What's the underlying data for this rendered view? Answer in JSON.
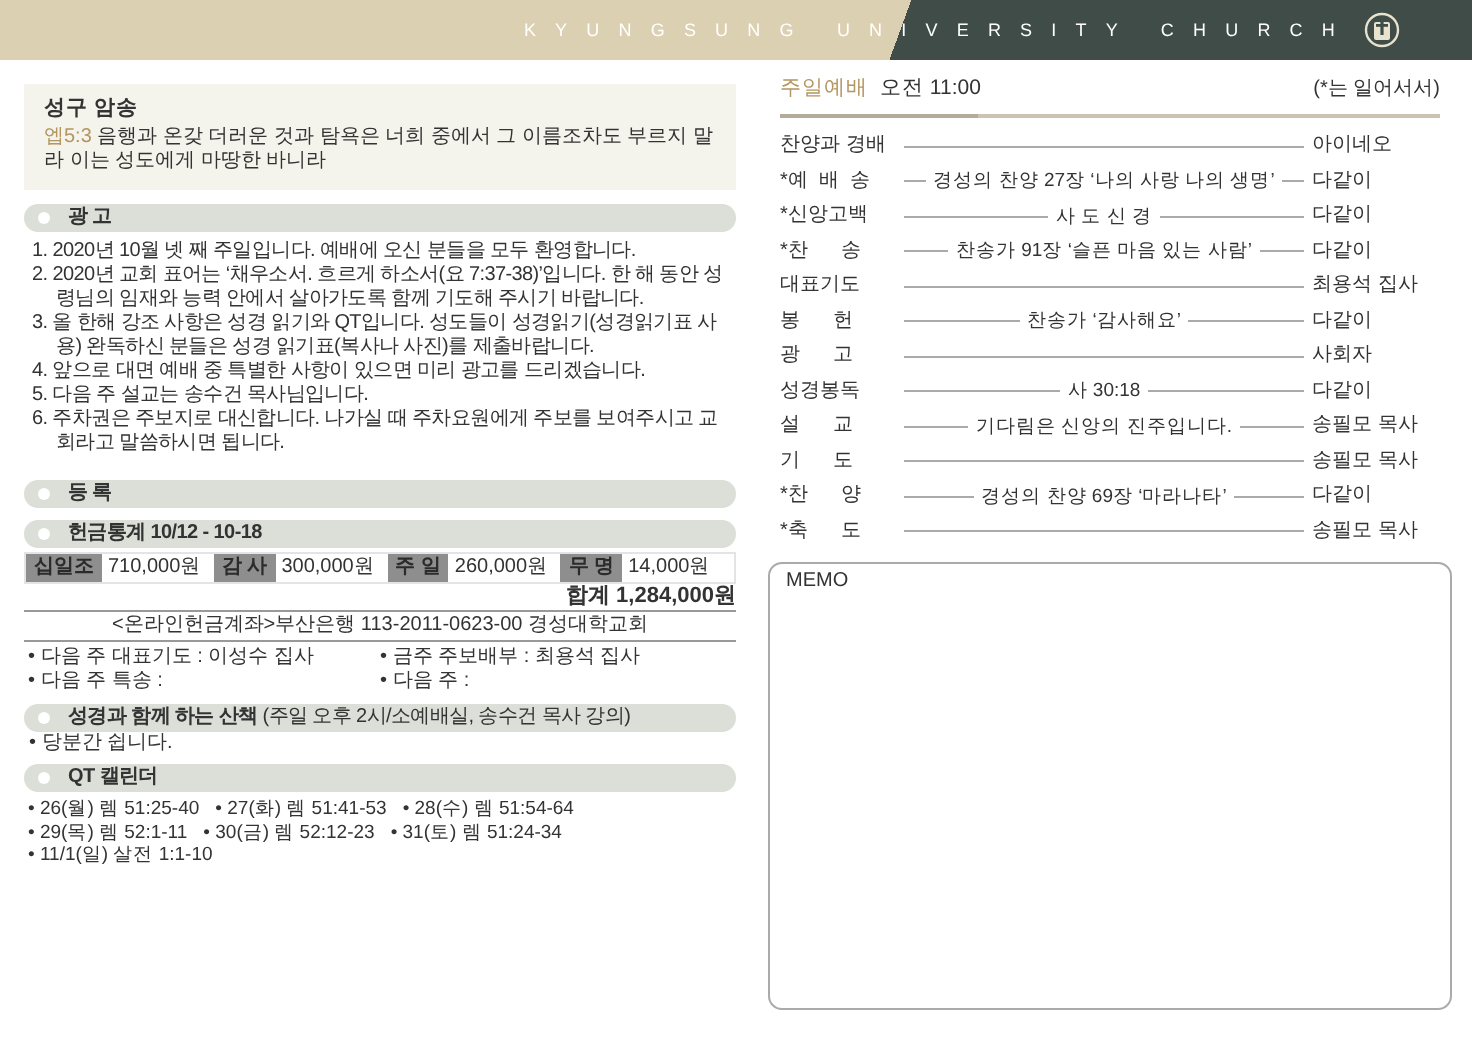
{
  "header": {
    "title": "KYUNGSUNG UNIVERSITY CHURCH"
  },
  "verse": {
    "title": "성구 암송",
    "reference": "엡5:3",
    "text": "음행과 온갖 더러운 것과 탐욕은 너희 중에서 그 이름조차도 부르지 말라 이는 성도에게 마땅한 바니라"
  },
  "announcements": {
    "title": "광 고",
    "items": [
      "1. 2020년 10월 넷 째 주일입니다. 예배에 오신 분들을 모두 환영합니다.",
      "2. 2020년 교회 표어는 ‘채우소서. 흐르게 하소서(요 7:37-38)’입니다. 한 해 동안 성령님의 임재와 능력 안에서 살아가도록 함께 기도해 주시기 바랍니다.",
      "3. 올 한해 강조 사항은 성경 읽기와 QT입니다. 성도들이 성경읽기(성경읽기표 사용) 완독하신 분들은 성경 읽기표(복사나 사진)를 제출바랍니다.",
      "4. 앞으로 대면 예배 중 특별한 사항이 있으면 미리 광고를 드리겠습니다.",
      "5. 다음 주 설교는 송수건 목사님입니다.",
      "6. 주차권은 주보지로 대신합니다. 나가실 때 주차요원에게 주보를 보여주시고 교회라고 말씀하시면 됩니다."
    ]
  },
  "registration": {
    "title": "등 록"
  },
  "offering": {
    "title": "헌금통계 10/12 - 10-18",
    "entries": [
      {
        "label": "십일조",
        "amount": "710,000원"
      },
      {
        "label": "감 사",
        "amount": "300,000원"
      },
      {
        "label": "주 일",
        "amount": "260,000원"
      },
      {
        "label": "무 명",
        "amount": "14,000원"
      }
    ],
    "total": "합계 1,284,000원",
    "account": "<온라인헌금계좌>부산은행 113-2011-0623-00 경성대학교회",
    "notes": [
      "• 다음 주 대표기도 : 이성수 집사",
      "• 금주 주보배부 : 최용석 집사",
      "• 다음 주 특송 :",
      "• 다음 주 :"
    ]
  },
  "walk": {
    "title": "**성경과 함께 하는 산책** (주일 오후 2시/소예배실, 송수건 목사 강의)",
    "items": [
      "• 당분간 쉽니다."
    ]
  },
  "qt": {
    "title": "QT 캘린더",
    "items": [
      "• 26(월) 렘 51:25-40",
      "• 27(화) 렘 51:41-53",
      "• 28(수) 렘 51:54-64",
      "• 29(목) 렘 52:1-11",
      "• 30(금) 렘 52:12-23",
      "• 31(토) 렘 51:24-34",
      "• 11/1(일) 살전 1:1-10"
    ]
  },
  "worship": {
    "title": "주일예배",
    "time": "오전 11:00",
    "note": "(*는 일어서서)",
    "order": [
      {
        "label": "찬양과 경배",
        "leader": "아이네오"
      },
      {
        "label": "*예  배  송",
        "detail": "경성의 찬양 27장 ‘나의 사랑 나의 생명’",
        "leader": "다같이"
      },
      {
        "label": "*신앙고백",
        "detail": "사 도 신 경",
        "leader": "다같이"
      },
      {
        "label": "*찬      송",
        "detail": "찬송가 91장 ‘슬픈 마음 있는 사람’",
        "leader": "다같이"
      },
      {
        "label": "대표기도",
        "leader": "최용석 집사"
      },
      {
        "label": "봉      헌",
        "detail": "찬송가 ‘감사해요’",
        "leader": "다같이"
      },
      {
        "label": "광      고",
        "leader": "사회자"
      },
      {
        "label": "성경봉독",
        "detail": "사 30:18",
        "leader": "다같이"
      },
      {
        "label": "설      교",
        "detail": "기다림은 신앙의 진주입니다.",
        "leader": "송필모 목사"
      },
      {
        "label": "기      도",
        "leader": "송필모 목사"
      },
      {
        "label": "*찬      양",
        "detail": "경성의 찬양 69장 ‘마라나타’",
        "leader": "다같이"
      },
      {
        "label": "*축      도",
        "leader": "송필모 목사"
      }
    ]
  },
  "memo": {
    "label": "MEMO"
  }
}
